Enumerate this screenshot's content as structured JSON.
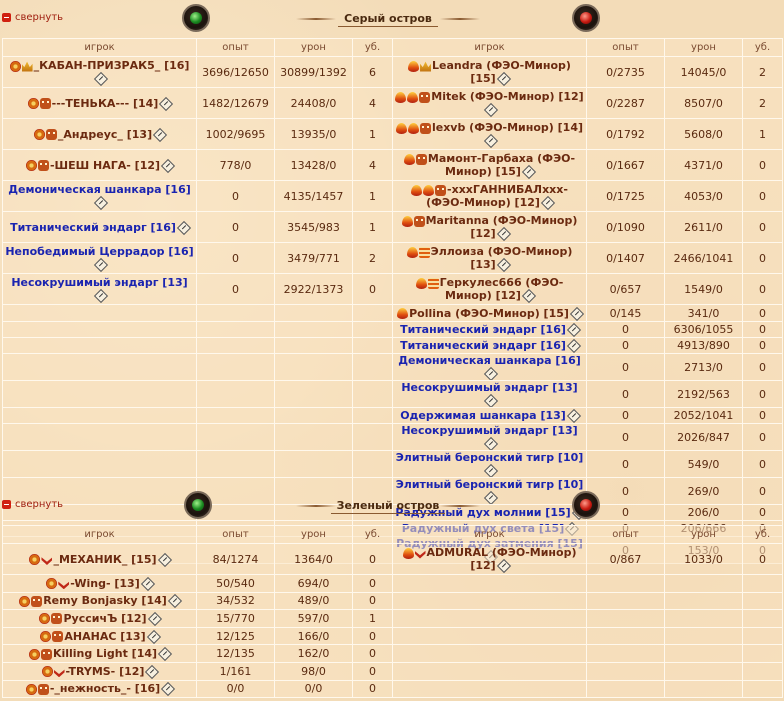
{
  "gray": {
    "collapse": "свернуть",
    "title": "Серый остров",
    "headers": [
      "игрок",
      "опыт",
      "урон",
      "уб.",
      "игрок",
      "опыт",
      "урон",
      "уб."
    ],
    "left": [
      {
        "name": "_КАБАН-ПРИЗРАК5_ [16]",
        "exp": "3696/12650",
        "dmg": "30899/1392",
        "kills": "6",
        "style": "name",
        "icons": [
          "swirl",
          "crown"
        ]
      },
      {
        "name": "---ТЕНЬКА--- [14]",
        "exp": "1482/12679",
        "dmg": "24408/0",
        "kills": "4",
        "style": "name",
        "icons": [
          "swirl",
          "skull"
        ]
      },
      {
        "name": "_Андреус_ [13]",
        "exp": "1002/9695",
        "dmg": "13935/0",
        "kills": "1",
        "style": "name",
        "icons": [
          "swirl",
          "skull"
        ]
      },
      {
        "name": "-ШЕШ НАГА- [12]",
        "exp": "778/0",
        "dmg": "13428/0",
        "kills": "4",
        "style": "name",
        "icons": [
          "swirl",
          "skull"
        ]
      },
      {
        "name": "Демоническая шанкара [16]",
        "exp": "0",
        "dmg": "4135/1457",
        "kills": "1",
        "style": "blue",
        "icons": []
      },
      {
        "name": "Титанический эндарг [16]",
        "exp": "0",
        "dmg": "3545/983",
        "kills": "1",
        "style": "blue",
        "icons": []
      },
      {
        "name": "Непобедимый Церрадор [16]",
        "exp": "0",
        "dmg": "3479/771",
        "kills": "2",
        "style": "blue",
        "icons": []
      },
      {
        "name": "Несокрушимый эндарг [13]",
        "exp": "0",
        "dmg": "2922/1373",
        "kills": "0",
        "style": "blue",
        "icons": []
      }
    ],
    "right": [
      {
        "name": "Leandra (ФЭО-Минор) [15]",
        "exp": "0/2735",
        "dmg": "14045/0",
        "kills": "2",
        "style": "name",
        "icons": [
          "flame",
          "crown"
        ]
      },
      {
        "name": "Mitek (ФЭО-Минор) [12]",
        "exp": "0/2287",
        "dmg": "8507/0",
        "kills": "2",
        "style": "name",
        "icons": [
          "flame",
          "flame",
          "skull"
        ]
      },
      {
        "name": "lexvb (ФЭО-Минор) [14]",
        "exp": "0/1792",
        "dmg": "5608/0",
        "kills": "1",
        "style": "name",
        "icons": [
          "flame",
          "flame",
          "skull"
        ]
      },
      {
        "name": "Мамонт-Гарбаха (ФЭО-Минор) [15]",
        "exp": "0/1667",
        "dmg": "4371/0",
        "kills": "0",
        "style": "name",
        "icons": [
          "flame",
          "skull"
        ]
      },
      {
        "name": "-xxxГАННИБАЛxxx- (ФЭО-Минор) [12]",
        "exp": "0/1725",
        "dmg": "4053/0",
        "kills": "0",
        "style": "name",
        "icons": [
          "flame",
          "flame",
          "skull"
        ]
      },
      {
        "name": "Maritanna (ФЭО-Минор) [12]",
        "exp": "0/1090",
        "dmg": "2611/0",
        "kills": "0",
        "style": "name",
        "icons": [
          "flame",
          "skull"
        ]
      },
      {
        "name": "Эллоиза (ФЭО-Минор) [13]",
        "exp": "0/1407",
        "dmg": "2466/1041",
        "kills": "0",
        "style": "name",
        "icons": [
          "flame",
          "stripe"
        ]
      },
      {
        "name": "Геркулес666 (ФЭО-Минор) [12]",
        "exp": "0/657",
        "dmg": "1549/0",
        "kills": "0",
        "style": "name",
        "icons": [
          "flame",
          "stripe"
        ]
      },
      {
        "name": "Pollina (ФЭО-Минор) [15]",
        "exp": "0/145",
        "dmg": "341/0",
        "kills": "0",
        "style": "name",
        "icons": [
          "flame"
        ]
      },
      {
        "name": "Титанический эндарг [16]",
        "exp": "0",
        "dmg": "6306/1055",
        "kills": "0",
        "style": "blue",
        "icons": []
      },
      {
        "name": "Титанический эндарг [16]",
        "exp": "0",
        "dmg": "4913/890",
        "kills": "0",
        "style": "blue",
        "icons": []
      },
      {
        "name": "Демоническая шанкара [16]",
        "exp": "0",
        "dmg": "2713/0",
        "kills": "0",
        "style": "blue",
        "icons": []
      },
      {
        "name": "Несокрушимый эндарг [13]",
        "exp": "0",
        "dmg": "2192/563",
        "kills": "0",
        "style": "blue",
        "icons": []
      },
      {
        "name": "Одержимая шанкара [13]",
        "exp": "0",
        "dmg": "2052/1041",
        "kills": "0",
        "style": "blue",
        "icons": []
      },
      {
        "name": "Несокрушимый эндарг [13]",
        "exp": "0",
        "dmg": "2026/847",
        "kills": "0",
        "style": "blue",
        "icons": []
      },
      {
        "name": "Элитный беронский тигр [10]",
        "exp": "0",
        "dmg": "549/0",
        "kills": "0",
        "style": "blue",
        "icons": []
      },
      {
        "name": "Элитный беронский тигр [10]",
        "exp": "0",
        "dmg": "269/0",
        "kills": "0",
        "style": "blue",
        "icons": []
      },
      {
        "name": "Радужный дух молнии [15]",
        "exp": "0",
        "dmg": "206/0",
        "kills": "0",
        "style": "blue",
        "icons": []
      },
      {
        "name": "Радужный дух света [15]",
        "exp": "0",
        "dmg": "206/666",
        "kills": "0",
        "style": "blue",
        "icons": []
      },
      {
        "name": "Радужный дух затмения [15]",
        "exp": "0",
        "dmg": "153/0",
        "kills": "0",
        "style": "blue",
        "icons": []
      }
    ]
  },
  "green": {
    "collapse": "свернуть",
    "title": "Зеленый остров",
    "headers": [
      "игрок",
      "опыт",
      "урон",
      "уб.",
      "игрок",
      "опыт",
      "урон",
      "уб."
    ],
    "left": [
      {
        "name": "_МЕХАНИК_ [15]",
        "exp": "84/1274",
        "dmg": "1364/0",
        "kills": "0",
        "style": "name",
        "icons": [
          "swirl",
          "wing"
        ]
      },
      {
        "name": "-Wing- [13]",
        "exp": "50/540",
        "dmg": "694/0",
        "kills": "0",
        "style": "name",
        "icons": [
          "swirl",
          "wing"
        ]
      },
      {
        "name": "Remy Bonjasky [14]",
        "exp": "34/532",
        "dmg": "489/0",
        "kills": "0",
        "style": "name",
        "icons": [
          "swirl",
          "skull"
        ]
      },
      {
        "name": "РуссичЪ [12]",
        "exp": "15/770",
        "dmg": "597/0",
        "kills": "1",
        "style": "name",
        "icons": [
          "swirl",
          "skull"
        ]
      },
      {
        "name": "АНАНАС [13]",
        "exp": "12/125",
        "dmg": "166/0",
        "kills": "0",
        "style": "name",
        "icons": [
          "swirl",
          "skull"
        ]
      },
      {
        "name": "Killing Light [14]",
        "exp": "12/135",
        "dmg": "162/0",
        "kills": "0",
        "style": "name",
        "icons": [
          "swirl",
          "skull"
        ]
      },
      {
        "name": "-TRYMS- [12]",
        "exp": "1/161",
        "dmg": "98/0",
        "kills": "0",
        "style": "name",
        "icons": [
          "swirl",
          "wing"
        ]
      },
      {
        "name": "-_нежность_- [16]",
        "exp": "0/0",
        "dmg": "0/0",
        "kills": "0",
        "style": "name",
        "icons": [
          "swirl",
          "skull"
        ]
      }
    ],
    "right": [
      {
        "name": "ADMURAL (ФЭО-Минор) [12]",
        "exp": "0/867",
        "dmg": "1033/0",
        "kills": "0",
        "style": "name",
        "icons": [
          "flame",
          "wing"
        ]
      }
    ]
  },
  "icons": {
    "swirl": "fire-swirl-icon",
    "flame": "flame-icon",
    "skull": "clan-skull-icon",
    "crown": "crown-icon",
    "wing": "wing-icon",
    "stripe": "striped-badge-icon",
    "info": "info-diamond-icon"
  }
}
